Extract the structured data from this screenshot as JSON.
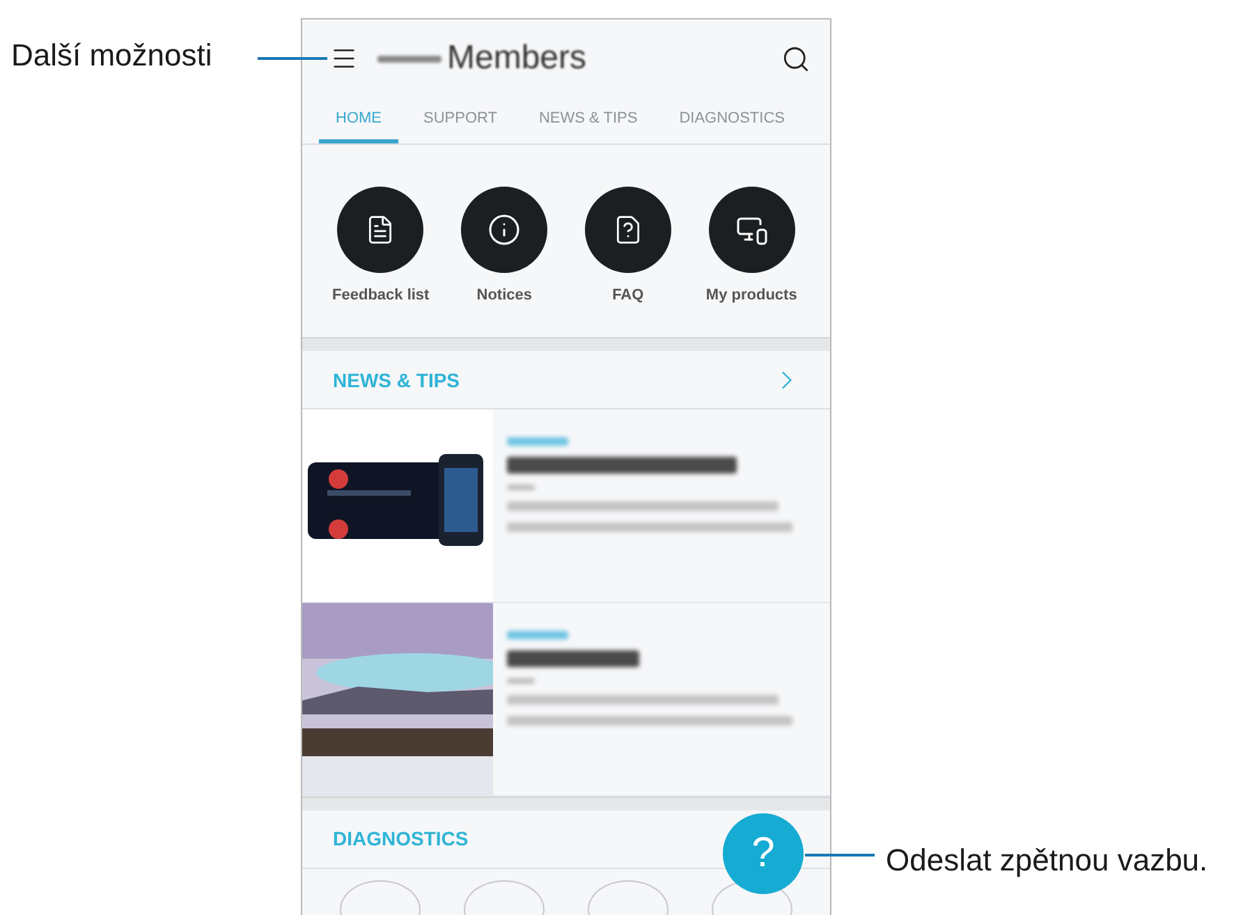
{
  "callouts": [
    {
      "label": "Další možnosti"
    },
    {
      "label": "Odeslat zpětnou vazbu."
    }
  ],
  "app_bar": {
    "title": "Members"
  },
  "tabs": [
    {
      "label": "HOME",
      "selected": true
    },
    {
      "label": "SUPPORT",
      "selected": false
    },
    {
      "label": "NEWS & TIPS",
      "selected": false
    },
    {
      "label": "DIAGNOSTICS",
      "selected": false
    }
  ],
  "shortcuts": [
    {
      "label": "Feedback list",
      "kind": "document"
    },
    {
      "label": "Notices",
      "kind": "info"
    },
    {
      "label": "FAQ",
      "kind": "faq"
    },
    {
      "label": "My products",
      "kind": "devices"
    }
  ],
  "news": {
    "title": "NEWS & TIPS",
    "articles": [
      {
        "kind": "devices"
      },
      {
        "kind": "landscape"
      }
    ]
  },
  "diagnostics": {
    "title": "DIAGNOSTICS"
  },
  "fab": {
    "label": "?"
  }
}
